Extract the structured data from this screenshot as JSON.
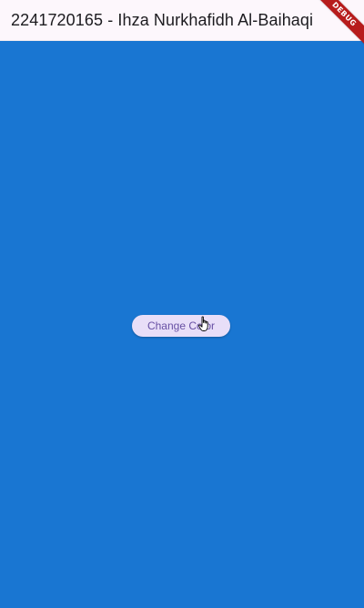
{
  "appbar": {
    "title": "2241720165 - Ihza Nurkhafidh Al-Baihaqi"
  },
  "debug_banner": {
    "label": "DEBUG"
  },
  "main": {
    "button_label": "Change Color"
  },
  "colors": {
    "background": "#1976d2",
    "appbar": "#fdf7fc",
    "button": "#e8def8",
    "button_text": "#6750a4",
    "debug_banner": "#b71c1c"
  },
  "icons": {
    "cursor": "hand-pointer-icon"
  }
}
